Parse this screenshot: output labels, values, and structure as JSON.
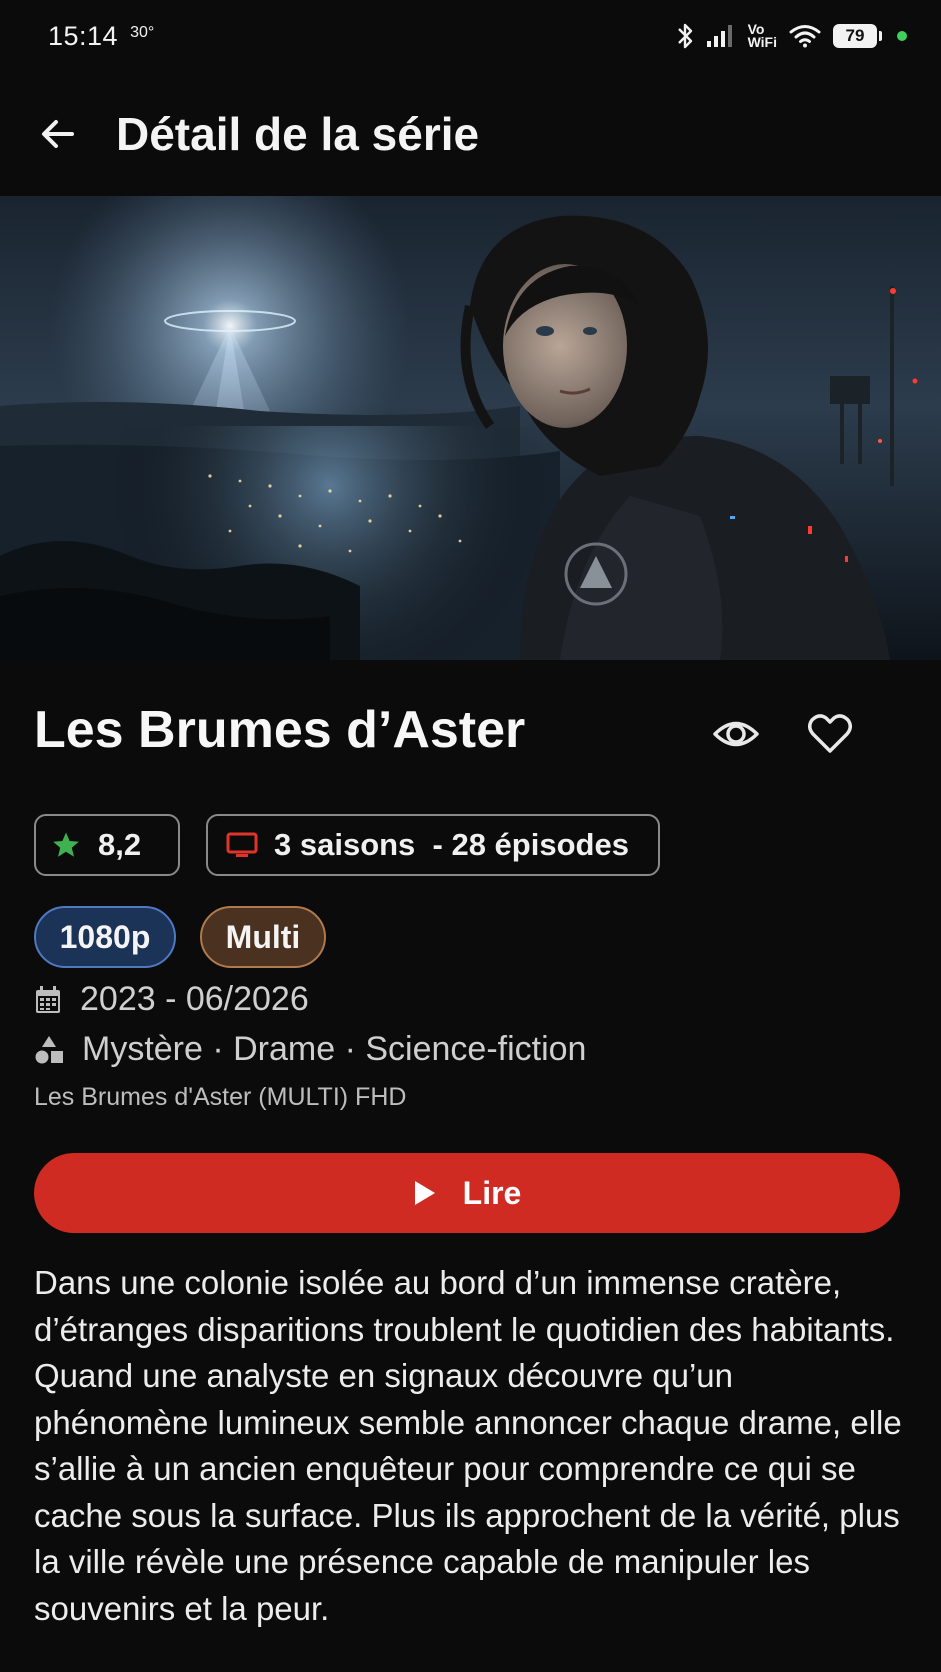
{
  "status_bar": {
    "time": "15:14",
    "temperature": "30°",
    "vowifi_top": "Vo",
    "vowifi_bottom": "WiFi",
    "battery": "79"
  },
  "app_bar": {
    "title": "Détail de la série"
  },
  "series": {
    "title": "Les Brumes d’Aster",
    "rating": "8,2",
    "seasons_episodes": "3 saisons  - 28 épisodes",
    "resolution": "1080p",
    "language": "Multi",
    "dates": "2023 - 06/2026",
    "genres": "Mystère · Drame · Science-fiction",
    "file_name": "Les Brumes d'Aster (MULTI) FHD",
    "play_label": "Lire",
    "synopsis": "Dans une colonie isolée au bord d’un immense cratère, d’étranges disparitions troublent le quotidien des habitants. Quand une analyste en signaux découvre qu’un phénomène lumineux semble annoncer chaque drame, elle s’allie à un ancien enquêteur pour comprendre ce qui se cache sous la surface. Plus ils approchent de la vérité, plus la ville révèle une présence capable de manipuler les souvenirs et la peur."
  },
  "colors": {
    "background": "#0b0b0c",
    "play_button": "#cf2b22",
    "star": "#3fb24f",
    "tv_icon": "#e0342a",
    "resolution_badge": "#1c3358",
    "language_badge": "#4a3120"
  },
  "icons": {
    "back": "arrow-left-icon",
    "watched": "eye-icon",
    "favorite": "heart-icon",
    "rating": "star-icon",
    "seasons": "tv-icon",
    "date": "calendar-icon",
    "genres": "shapes-icon",
    "play": "play-icon"
  }
}
